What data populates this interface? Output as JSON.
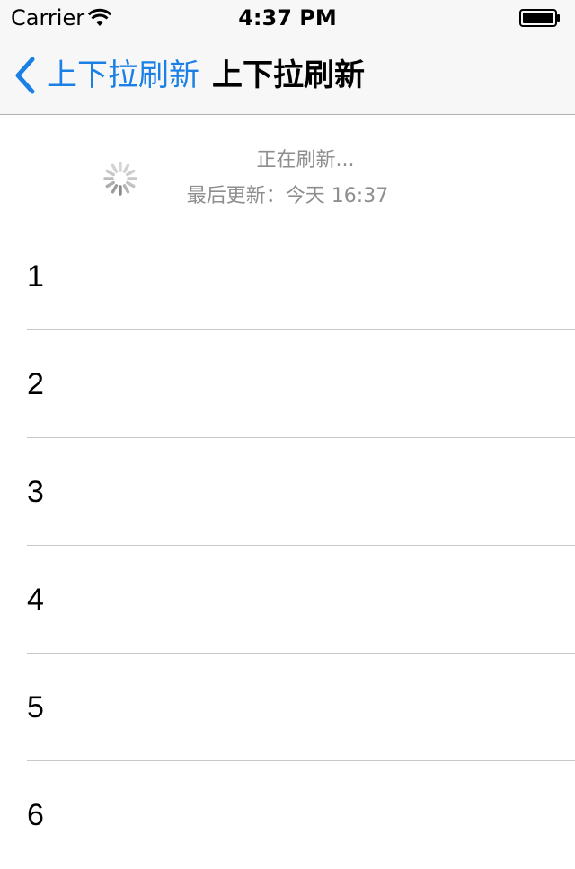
{
  "status_bar": {
    "carrier": "Carrier",
    "time": "4:37 PM",
    "wifi_icon": "wifi-icon",
    "battery_icon": "battery-icon"
  },
  "nav_bar": {
    "back_label": "上下拉刷新",
    "title": "上下拉刷新",
    "back_icon": "chevron-left-icon",
    "tint_color": "#1a80e6"
  },
  "refresh_header": {
    "status": "正在刷新...",
    "last_updated": "最后更新：今天 16:37",
    "spinner_icon": "activity-indicator-icon"
  },
  "list": {
    "rows": [
      {
        "label": "1"
      },
      {
        "label": "2"
      },
      {
        "label": "3"
      },
      {
        "label": "4"
      },
      {
        "label": "5"
      },
      {
        "label": "6"
      }
    ]
  }
}
